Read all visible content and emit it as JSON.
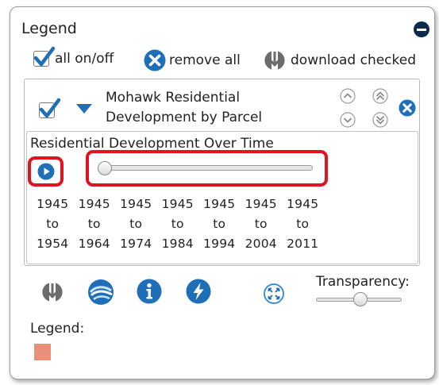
{
  "panel": {
    "title": "Legend",
    "collapse_icon": "minus-circle-icon"
  },
  "toolbar": {
    "all_on_off": {
      "label": "all on/off",
      "checked": true,
      "icon": "checkbox-check-icon"
    },
    "remove_all": {
      "label": "remove all",
      "icon": "remove-circle-icon"
    },
    "download_checked": {
      "label": "download checked",
      "icon": "download-icon"
    }
  },
  "layer": {
    "visible": true,
    "expand_icon": "caret-down-icon",
    "title_line1": "Mohawk Residential",
    "title_line2": "Development by Parcel",
    "move_icons": [
      "move-up-icon",
      "move-top-icon",
      "move-down-icon",
      "move-bottom-icon"
    ],
    "remove_icon": "remove-layer-icon"
  },
  "time_slider": {
    "title": "Residential Development Over Time",
    "play_icon": "play-icon",
    "current_period_index": 0,
    "periods": [
      {
        "start": "1945",
        "to": "to",
        "end": "1954"
      },
      {
        "start": "1945",
        "to": "to",
        "end": "1964"
      },
      {
        "start": "1945",
        "to": "to",
        "end": "1974"
      },
      {
        "start": "1945",
        "to": "to",
        "end": "1984"
      },
      {
        "start": "1945",
        "to": "to",
        "end": "1994"
      },
      {
        "start": "1945",
        "to": "to",
        "end": "2004"
      },
      {
        "start": "1945",
        "to": "to",
        "end": "2011"
      }
    ]
  },
  "layer_tools": {
    "download_icon": "download-icon",
    "zoom_to_icon": "zoom-to-layer-icon",
    "info_icon": "info-icon",
    "quick_query_icon": "lightning-icon",
    "fullscreen_icon": "expand-arrows-icon"
  },
  "transparency": {
    "label": "Transparency:",
    "value_fraction": 0.52
  },
  "legend": {
    "label": "Legend:",
    "swatch_color": "#e8907a"
  },
  "colors": {
    "icon_blue": "#1e6fb8",
    "icon_dark": "#0c2a4d",
    "highlight_red": "#e0141e"
  }
}
